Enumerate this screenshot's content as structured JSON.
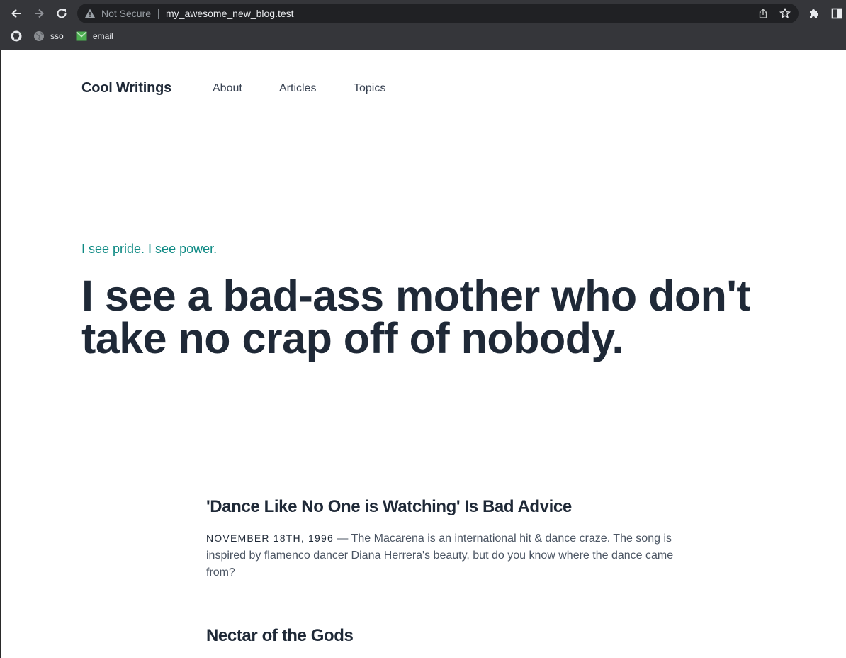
{
  "browser": {
    "security_label": "Not Secure",
    "url": "my_awesome_new_blog.test",
    "bookmarks": [
      {
        "label": "",
        "icon": "github-icon"
      },
      {
        "label": "sso",
        "icon": "globe-icon"
      },
      {
        "label": "email",
        "icon": "email-icon"
      }
    ]
  },
  "site": {
    "brand": "Cool Writings",
    "nav": [
      "About",
      "Articles",
      "Topics"
    ]
  },
  "hero": {
    "eyebrow": "I see pride. I see power.",
    "headline": "I see a bad-ass mother who don't take no crap off of nobody."
  },
  "articles": [
    {
      "title": "'Dance Like No One is Watching' Is Bad Advice",
      "date": "November 18th, 1996",
      "separator": " — ",
      "excerpt": "The Macarena is an international hit & dance craze. The song is inspired by flamenco dancer Diana Herrera's beauty, but do you know where the dance came from?"
    },
    {
      "title": "Nectar of the Gods"
    }
  ],
  "colors": {
    "accent": "#0f8a84",
    "text_dark": "#1f2937",
    "chrome_bg": "#35363a",
    "omnibox_bg": "#202124"
  }
}
